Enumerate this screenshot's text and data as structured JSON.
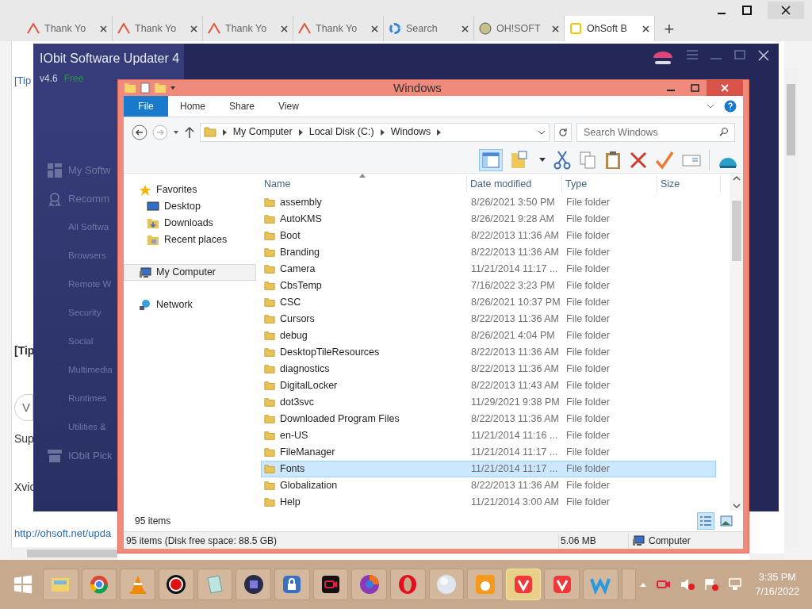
{
  "browser": {
    "tabs": [
      {
        "label": "Thank Yo",
        "selected": false
      },
      {
        "label": "Thank Yo",
        "selected": false
      },
      {
        "label": "Thank Yo",
        "selected": false
      },
      {
        "label": "Thank Yo",
        "selected": false
      },
      {
        "label": "Search",
        "selected": false
      },
      {
        "label": "OH!SOFT",
        "selected": false
      },
      {
        "label": "OhSoft B",
        "selected": true
      }
    ],
    "new_tab": "+",
    "page_texts": [
      {
        "kind": "tip",
        "text": "[Tip"
      },
      {
        "kind": "tipbold",
        "text": "[Tip"
      },
      {
        "kind": "pill",
        "text": "V"
      },
      {
        "kind": "plain",
        "text": "Sup"
      },
      {
        "kind": "plain",
        "text": "Xvic"
      },
      {
        "kind": "link",
        "text": "http://ohsoft.net/upda"
      }
    ]
  },
  "updater": {
    "title": "IObit Software Updater 4",
    "version": "v4.6",
    "edition": "Free",
    "nav": [
      {
        "label": "My Softw",
        "kind": "main"
      },
      {
        "label": "Recomm",
        "kind": "main"
      },
      {
        "label": "All Softwa",
        "kind": "sub"
      },
      {
        "label": "Browsers",
        "kind": "sub"
      },
      {
        "label": "Remote W",
        "kind": "sub"
      },
      {
        "label": "Security",
        "kind": "sub"
      },
      {
        "label": "Social",
        "kind": "sub"
      },
      {
        "label": "Multimedia",
        "kind": "sub"
      },
      {
        "label": "Runtimes",
        "kind": "sub"
      },
      {
        "label": "Utilities &",
        "kind": "sub"
      },
      {
        "label": "IObit Pick",
        "kind": "main"
      }
    ]
  },
  "explorer": {
    "title": "Windows",
    "ribbon_tabs": [
      {
        "label": "File",
        "selected": true
      },
      {
        "label": "Home",
        "selected": false
      },
      {
        "label": "Share",
        "selected": false
      },
      {
        "label": "View",
        "selected": false
      }
    ],
    "breadcrumb": [
      "My Computer",
      "Local Disk (C:)",
      "Windows"
    ],
    "search": {
      "placeholder": "Search Windows"
    },
    "nav_pane": [
      {
        "label": "Favorites",
        "selected": false,
        "children": [
          {
            "label": "Desktop",
            "selected": false
          },
          {
            "label": "Downloads",
            "selected": false
          },
          {
            "label": "Recent places",
            "selected": false
          }
        ]
      },
      {
        "label": "My Computer",
        "selected": true
      },
      {
        "label": "Network",
        "selected": false
      }
    ],
    "columns": [
      "Name",
      "Date modified",
      "Type",
      "Size"
    ],
    "rows": [
      {
        "name": "assembly",
        "date": "8/26/2021 3:50 PM",
        "type": "File folder",
        "selected": false
      },
      {
        "name": "AutoKMS",
        "date": "8/26/2021 9:28 AM",
        "type": "File folder",
        "selected": false
      },
      {
        "name": "Boot",
        "date": "8/22/2013 11:36 AM",
        "type": "File folder",
        "selected": false
      },
      {
        "name": "Branding",
        "date": "8/22/2013 11:36 AM",
        "type": "File folder",
        "selected": false
      },
      {
        "name": "Camera",
        "date": "11/21/2014 11:17 ...",
        "type": "File folder",
        "selected": false
      },
      {
        "name": "CbsTemp",
        "date": "7/16/2022 3:23 PM",
        "type": "File folder",
        "selected": false
      },
      {
        "name": "CSC",
        "date": "8/26/2021 10:37 PM",
        "type": "File folder",
        "selected": false
      },
      {
        "name": "Cursors",
        "date": "8/22/2013 11:36 AM",
        "type": "File folder",
        "selected": false
      },
      {
        "name": "debug",
        "date": "8/26/2021 4:04 PM",
        "type": "File folder",
        "selected": false
      },
      {
        "name": "DesktopTileResources",
        "date": "8/22/2013 11:36 AM",
        "type": "File folder",
        "selected": false
      },
      {
        "name": "diagnostics",
        "date": "8/22/2013 11:36 AM",
        "type": "File folder",
        "selected": false
      },
      {
        "name": "DigitalLocker",
        "date": "8/22/2013 11:43 AM",
        "type": "File folder",
        "selected": false
      },
      {
        "name": "dot3svc",
        "date": "11/29/2021 9:38 PM",
        "type": "File folder",
        "selected": false
      },
      {
        "name": "Downloaded Program Files",
        "date": "8/22/2013 11:36 AM",
        "type": "File folder",
        "selected": false
      },
      {
        "name": "en-US",
        "date": "11/21/2014 11:16 ...",
        "type": "File folder",
        "selected": false
      },
      {
        "name": "FileManager",
        "date": "11/21/2014 11:17 ...",
        "type": "File folder",
        "selected": false
      },
      {
        "name": "Fonts",
        "date": "11/21/2014 11:17 ...",
        "type": "File folder",
        "selected": true
      },
      {
        "name": "Globalization",
        "date": "8/22/2013 11:36 AM",
        "type": "File folder",
        "selected": false
      },
      {
        "name": "Help",
        "date": "11/21/2014 3:00 AM",
        "type": "File folder",
        "selected": false
      }
    ],
    "item_count": "95 items",
    "views": [
      {
        "kind": "details",
        "selected": true
      },
      {
        "kind": "large",
        "selected": false
      }
    ],
    "status_bar": {
      "summary": "95 items (Disk free space: 88.5 GB)",
      "size": "5.06 MB",
      "location": "Computer"
    }
  },
  "taskbar": {
    "time": "3:35 PM",
    "date": "7/16/2022"
  }
}
